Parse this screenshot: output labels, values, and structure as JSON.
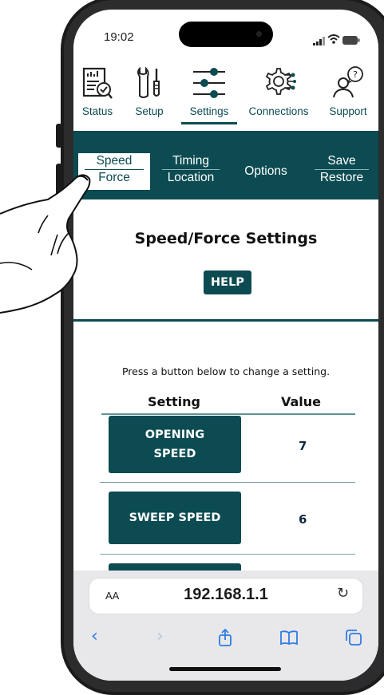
{
  "status_bar": {
    "time": "19:02"
  },
  "nav": {
    "items": [
      {
        "label": "Status",
        "icon": "status-report-icon"
      },
      {
        "label": "Setup",
        "icon": "tools-icon"
      },
      {
        "label": "Settings",
        "icon": "sliders-icon",
        "active": true
      },
      {
        "label": "Connections",
        "icon": "circuit-gear-icon"
      },
      {
        "label": "Support",
        "icon": "person-question-icon"
      }
    ]
  },
  "subtabs": [
    {
      "line1": "Speed",
      "line2": "Force",
      "active": true
    },
    {
      "line1": "Timing",
      "line2": "Location"
    },
    {
      "line1": "Options",
      "line2": ""
    },
    {
      "line1": "Save",
      "line2": "Restore"
    }
  ],
  "page": {
    "title": "Speed/Force Settings",
    "help_label": "HELP",
    "instruction": "Press a button below to change a setting.",
    "col_setting": "Setting",
    "col_value": "Value",
    "rows": [
      {
        "line1": "OPENING",
        "line2": "SPEED",
        "value": "7"
      },
      {
        "line1": "SWEEP SPEED",
        "line2": "",
        "value": "6"
      }
    ]
  },
  "browser": {
    "aa": "AA",
    "url": "192.168.1.1"
  },
  "colors": {
    "accent": "#0c4b52",
    "browser_accent": "#2f7be5"
  }
}
